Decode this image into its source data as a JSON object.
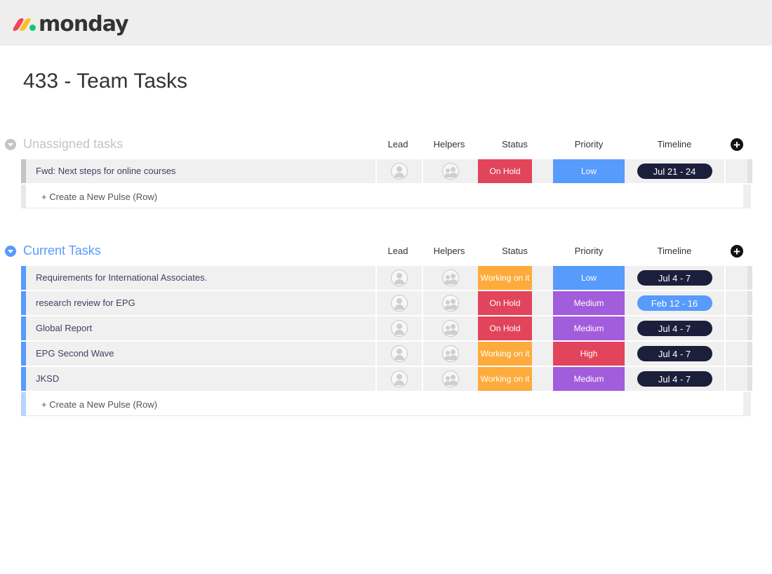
{
  "brand": {
    "logo_text": "monday"
  },
  "board": {
    "title": "433 - Team Tasks"
  },
  "columns": [
    "Lead",
    "Helpers",
    "Status",
    "Priority",
    "Timeline"
  ],
  "create_row_label": "+ Create a New Pulse (Row)",
  "colors": {
    "on_hold": "#e2445c",
    "working_on_it": "#fdab3d",
    "low": "#579bfc",
    "medium": "#a25ddc",
    "high": "#e2445c",
    "timeline_dark": "#1c1f3b",
    "timeline_light": "#579bfc",
    "unassigned_stripe": "#c4c4c4",
    "current_stripe": "#579bfc",
    "current_title": "#579bfc",
    "unassigned_title": "#c4c4c4"
  },
  "groups": [
    {
      "title": "Unassigned tasks",
      "color": "#c4c4c4",
      "rows": [
        {
          "name": "Fwd: Next steps for online courses",
          "status": "On Hold",
          "status_color": "#e2445c",
          "priority": "Low",
          "priority_color": "#579bfc",
          "timeline": "Jul 21 - 24",
          "timeline_color": "#1c1f3b"
        }
      ]
    },
    {
      "title": "Current Tasks",
      "color": "#579bfc",
      "rows": [
        {
          "name": "Requirements for International Associates.",
          "status": "Working on it",
          "status_color": "#fdab3d",
          "priority": "Low",
          "priority_color": "#579bfc",
          "timeline": "Jul 4 - 7",
          "timeline_color": "#1c1f3b"
        },
        {
          "name": "research review for EPG",
          "status": "On Hold",
          "status_color": "#e2445c",
          "priority": "Medium",
          "priority_color": "#a25ddc",
          "timeline": "Feb 12 - 16",
          "timeline_color": "#579bfc"
        },
        {
          "name": "Global Report",
          "status": "On Hold",
          "status_color": "#e2445c",
          "priority": "Medium",
          "priority_color": "#a25ddc",
          "timeline": "Jul 4 - 7",
          "timeline_color": "#1c1f3b"
        },
        {
          "name": "EPG Second Wave",
          "status": "Working on it",
          "status_color": "#fdab3d",
          "priority": "High",
          "priority_color": "#e2445c",
          "timeline": "Jul 4 - 7",
          "timeline_color": "#1c1f3b"
        },
        {
          "name": "JKSD",
          "status": "Working on it",
          "status_color": "#fdab3d",
          "priority": "Medium",
          "priority_color": "#a25ddc",
          "timeline": "Jul 4 - 7",
          "timeline_color": "#1c1f3b"
        }
      ]
    }
  ]
}
